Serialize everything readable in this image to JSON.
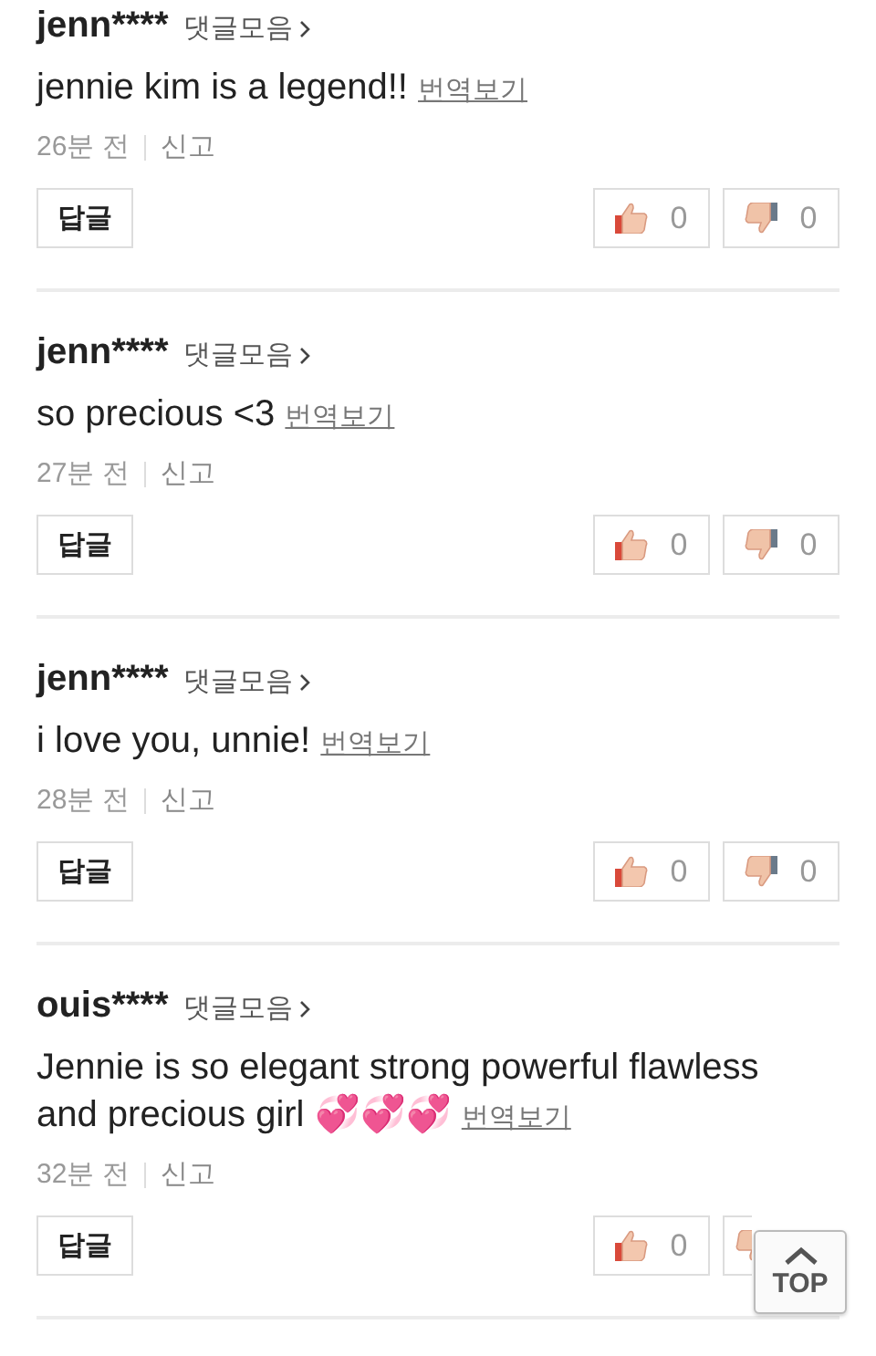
{
  "comments": [
    {
      "user": "jenn****",
      "collection_link": "댓글모음",
      "text": "jennie kim is a legend!!",
      "translate_link": "번역보기",
      "time": "26분 전",
      "report_link": "신고",
      "reply_button": "답글",
      "like_count": "0",
      "dislike_count": "0"
    },
    {
      "user": "jenn****",
      "collection_link": "댓글모음",
      "text": "so precious <3",
      "translate_link": "번역보기",
      "time": "27분 전",
      "report_link": "신고",
      "reply_button": "답글",
      "like_count": "0",
      "dislike_count": "0"
    },
    {
      "user": "jenn****",
      "collection_link": "댓글모음",
      "text": "i love you, unnie!",
      "translate_link": "번역보기",
      "time": "28분 전",
      "report_link": "신고",
      "reply_button": "답글",
      "like_count": "0",
      "dislike_count": "0"
    },
    {
      "user": "ouis****",
      "collection_link": "댓글모음",
      "text": "Jennie is so elegant strong powerful flawless and precious girl 💞💞💞",
      "translate_link": "번역보기",
      "time": "32분 전",
      "report_link": "신고",
      "reply_button": "답글",
      "like_count": "0"
    }
  ],
  "top_button": "TOP"
}
